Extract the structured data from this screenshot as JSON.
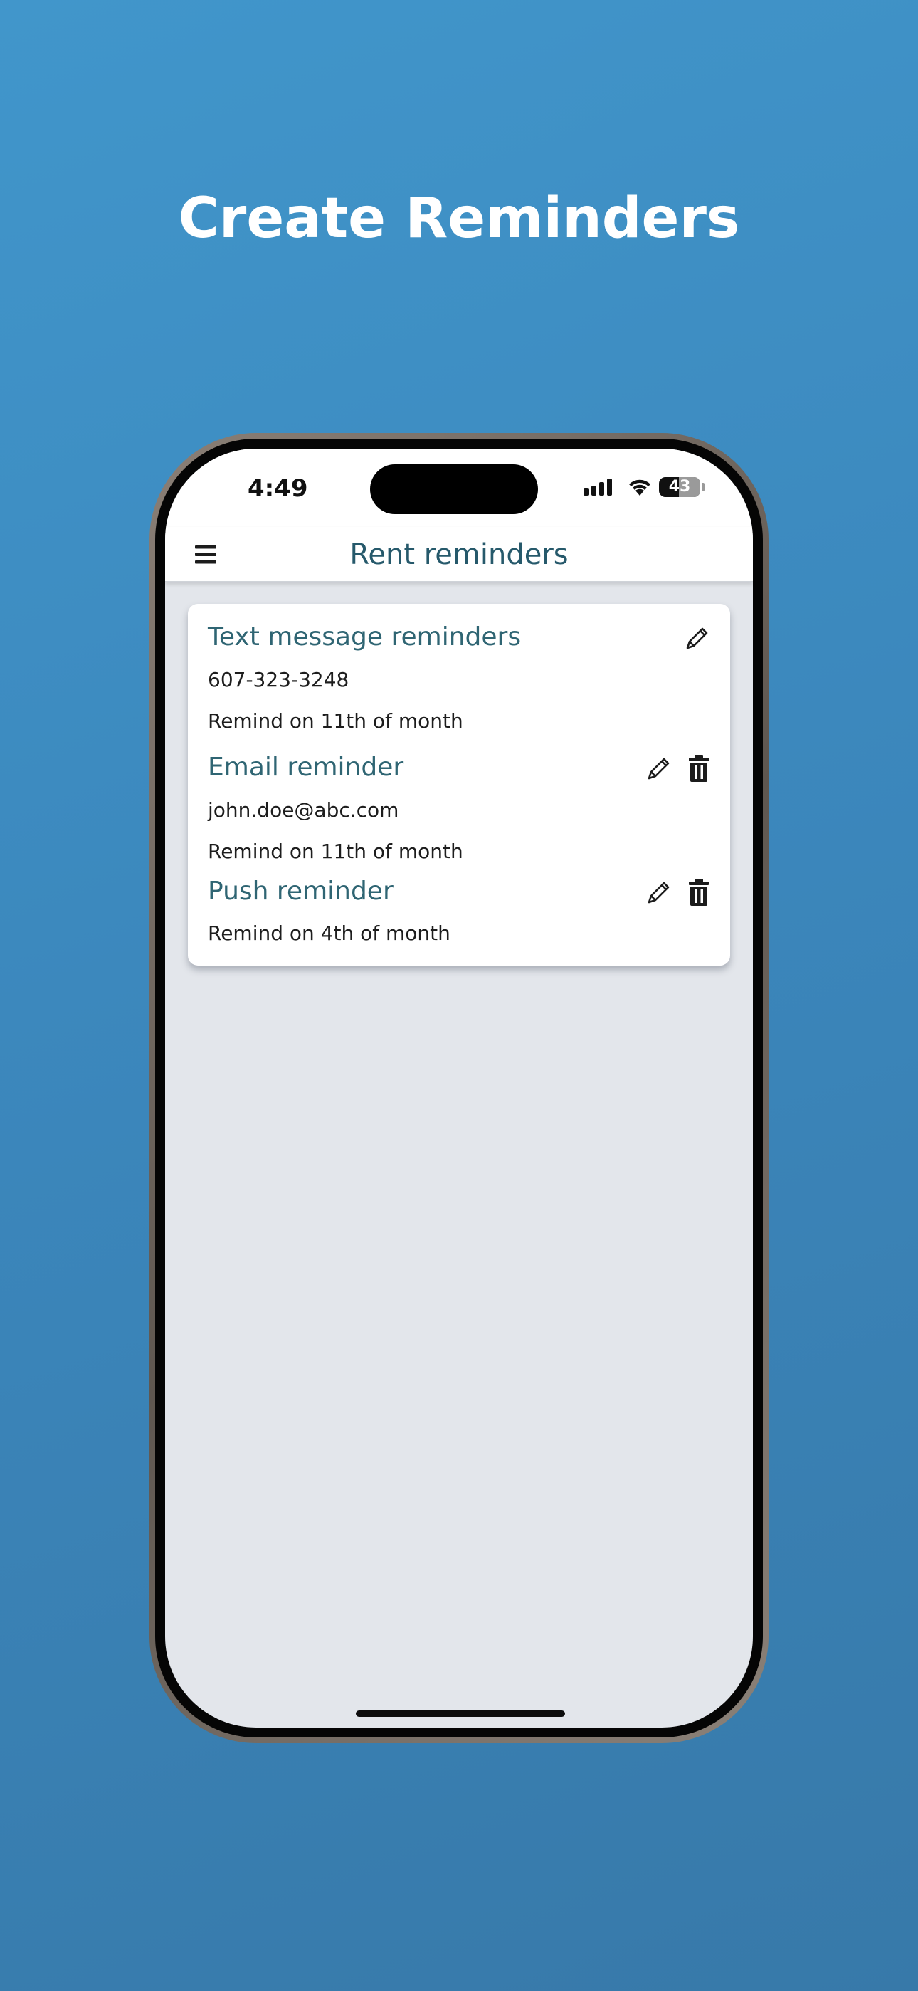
{
  "headline": "Create Reminders",
  "status_bar": {
    "time": "4:49",
    "battery": "43"
  },
  "nav": {
    "title": "Rent reminders",
    "menu_icon": "hamburger-menu-icon"
  },
  "reminders": [
    {
      "title": "Text message reminders",
      "detail": "607-323-3248",
      "schedule": "Remind on 11th of month",
      "actions": [
        "edit"
      ]
    },
    {
      "title": "Email reminder",
      "detail": "john.doe@abc.com",
      "schedule": "Remind on 11th of month",
      "actions": [
        "edit",
        "delete"
      ]
    },
    {
      "title": "Push reminder",
      "schedule": "Remind on 4th of month",
      "actions": [
        "edit",
        "delete"
      ]
    }
  ],
  "colors": {
    "background_top": "#4196cb",
    "background_bottom": "#3779a9",
    "title_accent": "#26596b",
    "screen_bg": "#e3e6eb"
  }
}
